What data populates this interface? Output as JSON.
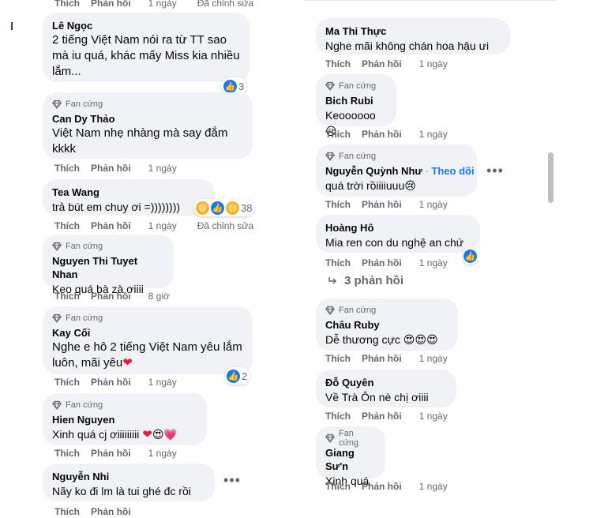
{
  "labels": {
    "like": "Thích",
    "reply": "Phản hồi",
    "fan_badge": "Fan cứng",
    "edited": "Đã chỉnh sửa",
    "follow": "Theo dõi"
  },
  "left_top_actions": {
    "time": "1 ngày"
  },
  "left_comments": [
    {
      "author": "Lê Ngọc",
      "text": "2 tiếng Việt Nam nói ra từ TT sao mà iu quá, khác mấy Miss kia nhiều lắm...",
      "time": "1 ngày",
      "reaction_count": "3"
    },
    {
      "author": "Can Dy Thảo",
      "text": "Việt Nam nhẹ nhàng mà say đắm kkkk",
      "time": "1 ngày"
    },
    {
      "author": "Tea Wang",
      "text": "trả bút em chuy ơi =))))))))",
      "time": "1 ngày",
      "reaction_count": "38"
    },
    {
      "author": "Nguyen Thi Tuyet Nhan",
      "text": "Keo quá bà zà ơiiii",
      "time": "8 giờ"
    },
    {
      "author": "Kay Cối",
      "text": "Nghe e hô 2 tiếng Việt Nam yêu lắm luôn, mãi yêu",
      "time": "1 ngày",
      "reaction_count": "2"
    },
    {
      "author": "Hien Nguyen",
      "text": "Xinh quá cj ơiiiiiiiii",
      "time": "1 ngày"
    },
    {
      "author": "Nguyễn Nhi",
      "text": "Nãy ko đi lm là tui ghé đc rồi",
      "time": ""
    }
  ],
  "right_comments": [
    {
      "author": "Ma Thi Thực",
      "text": "Nghe mãi không chán hoa hậu ưi",
      "time": "1 ngày"
    },
    {
      "author": "Bich Rubi",
      "text": "Keoooooo",
      "time": "1 ngày"
    },
    {
      "author": "Nguyễn Quỳnh Như",
      "text": "quá trời rồiiiiuuu",
      "time": "1 ngày"
    },
    {
      "author": "Hoàng Hô",
      "text": "Mia ren con du nghệ an chứ",
      "time": "1 ngày"
    },
    {
      "author": "Châu Ruby",
      "text": "Dễ thương cực",
      "time": "1 ngày"
    },
    {
      "author": "Đỗ Quyên",
      "text": "Về Trà Ôn nè chị ơiiii",
      "time": "1 ngày"
    },
    {
      "author": "Giang Sư'n",
      "text": "Xinh quá",
      "time": "1 ngày"
    }
  ],
  "replies_link": "3 phản hồi",
  "colors": {
    "bubble": "#f0f2f5",
    "secondary_text": "#65676b",
    "link_blue": "#1877f2",
    "like_blue": "#1877f2",
    "heart_red": "#e41e3f"
  },
  "icons": [
    "fan-badge-diamond-icon",
    "like-reaction-icon",
    "haha-reaction-icon",
    "sad-reaction-icon",
    "heart-eyes-emoji-icon",
    "red-heart-icon",
    "more-options-icon",
    "reply-arrow-icon"
  ]
}
